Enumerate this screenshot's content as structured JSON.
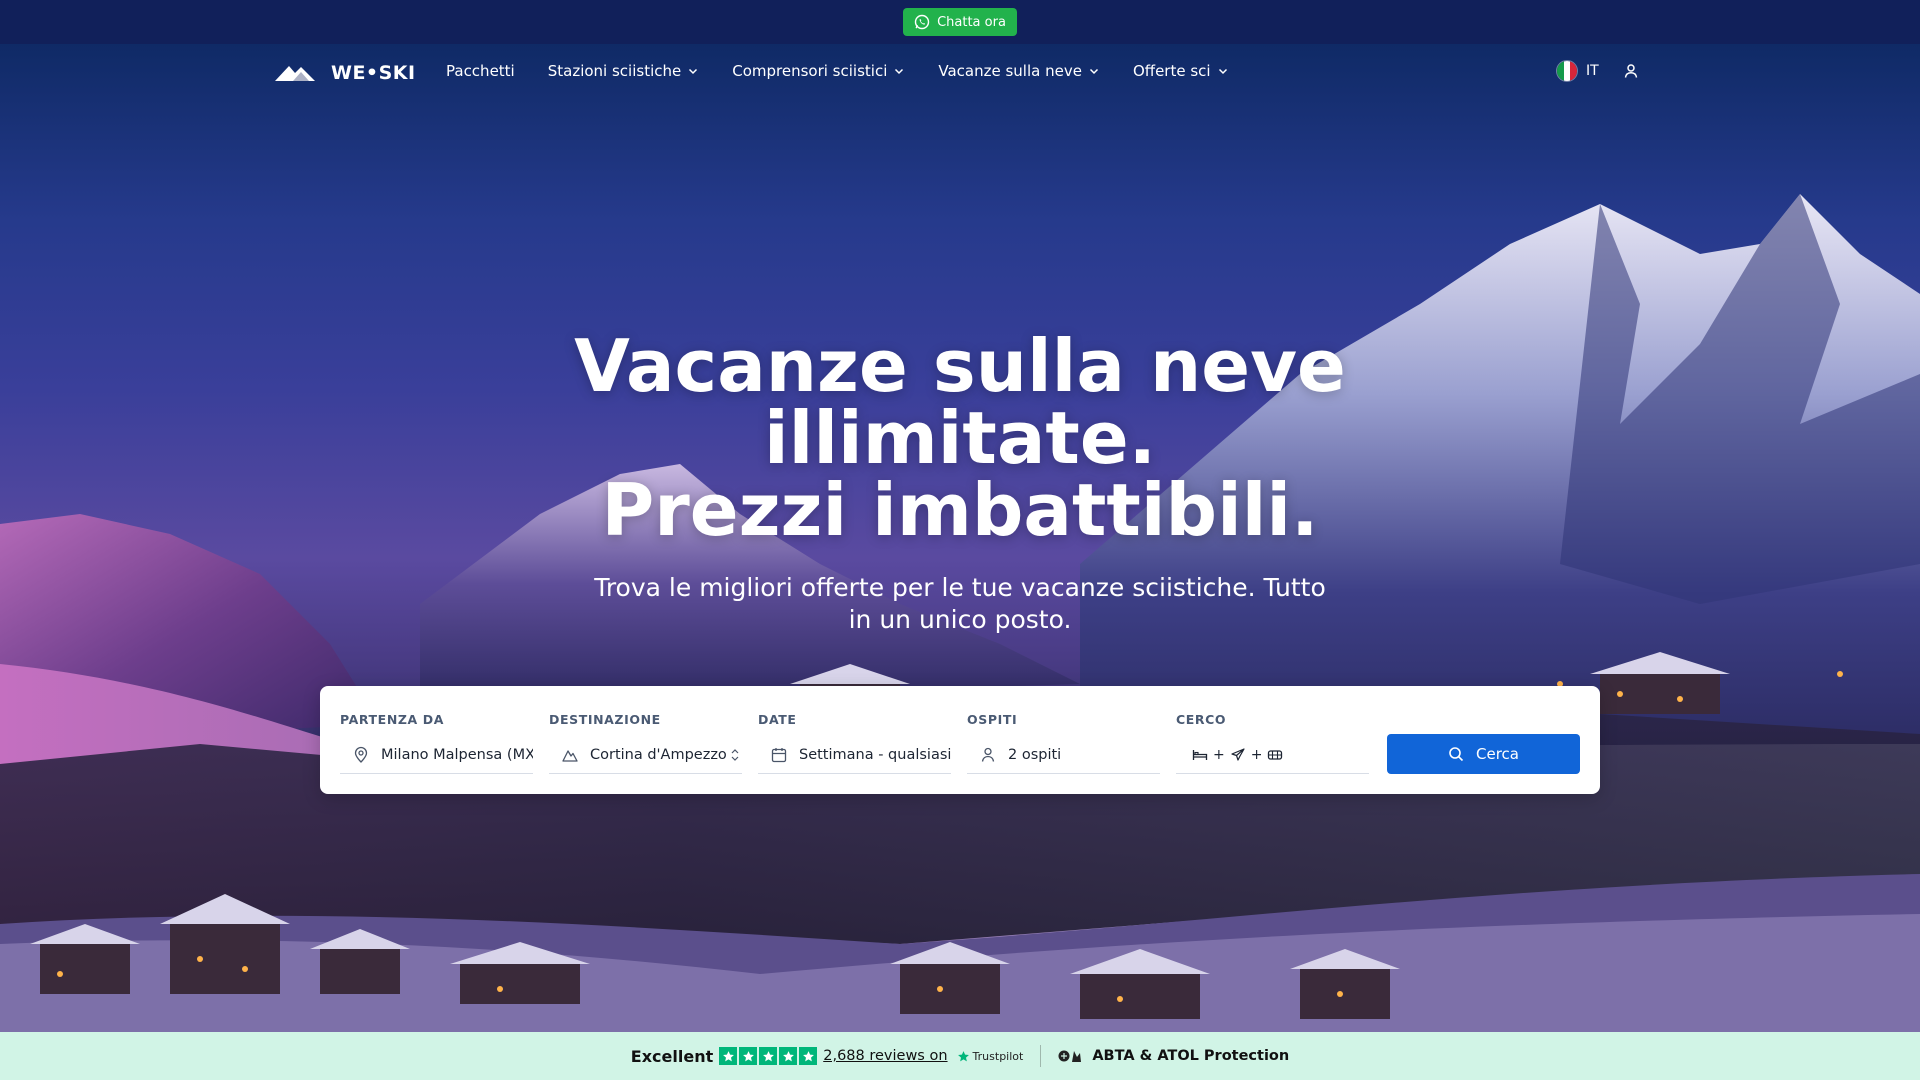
{
  "promo": {
    "chat_label": "Chatta ora",
    "chat_icon": "whatsapp-icon",
    "chat_color": "#22b24c"
  },
  "nav": {
    "logo_text": "WE•SKI",
    "items": [
      {
        "label": "Pacchetti",
        "dropdown": false
      },
      {
        "label": "Stazioni sciistiche",
        "dropdown": true
      },
      {
        "label": "Comprensori sciistici",
        "dropdown": true
      },
      {
        "label": "Vacanze sulla neve",
        "dropdown": true
      },
      {
        "label": "Offerte sci",
        "dropdown": true
      }
    ],
    "language": "IT",
    "flag_icon": "italy-flag-icon",
    "account_icon": "user-icon"
  },
  "hero": {
    "headline_line1": "Vacanze sulla neve",
    "headline_line2": "illimitate.",
    "headline_line3": "Prezzi imbattibili.",
    "subheadline": "Trova le migliori offerte per le tue vacanze sciistiche. Tutto in un unico posto."
  },
  "search": {
    "fields": [
      {
        "label": "PARTENZA DA",
        "value": "Milano Malpensa (MXP)",
        "icon": "location-pin-icon"
      },
      {
        "label": "DESTINAZIONE",
        "value": "Cortina d'Ampezzo",
        "icon": "mountain-icon"
      },
      {
        "label": "DATE",
        "value": "Settimana - qualsiasi",
        "icon": "calendar-icon"
      },
      {
        "label": "OSPITI",
        "value": "2 ospiti",
        "icon": "person-icon"
      },
      {
        "label": "CERCO",
        "value": "",
        "icon": "bed-plane-ski-icons"
      }
    ],
    "cerco_plus": "+",
    "button_label": "Cerca",
    "button_color": "#1165d8"
  },
  "trust": {
    "rating_word": "Excellent",
    "stars": 5,
    "reviews_text": "2,688 reviews on",
    "provider": "Trustpilot",
    "protection_text": "ABTA & ATOL Protection",
    "star_color": "#00b67a",
    "bar_color": "#d1f4e6"
  }
}
